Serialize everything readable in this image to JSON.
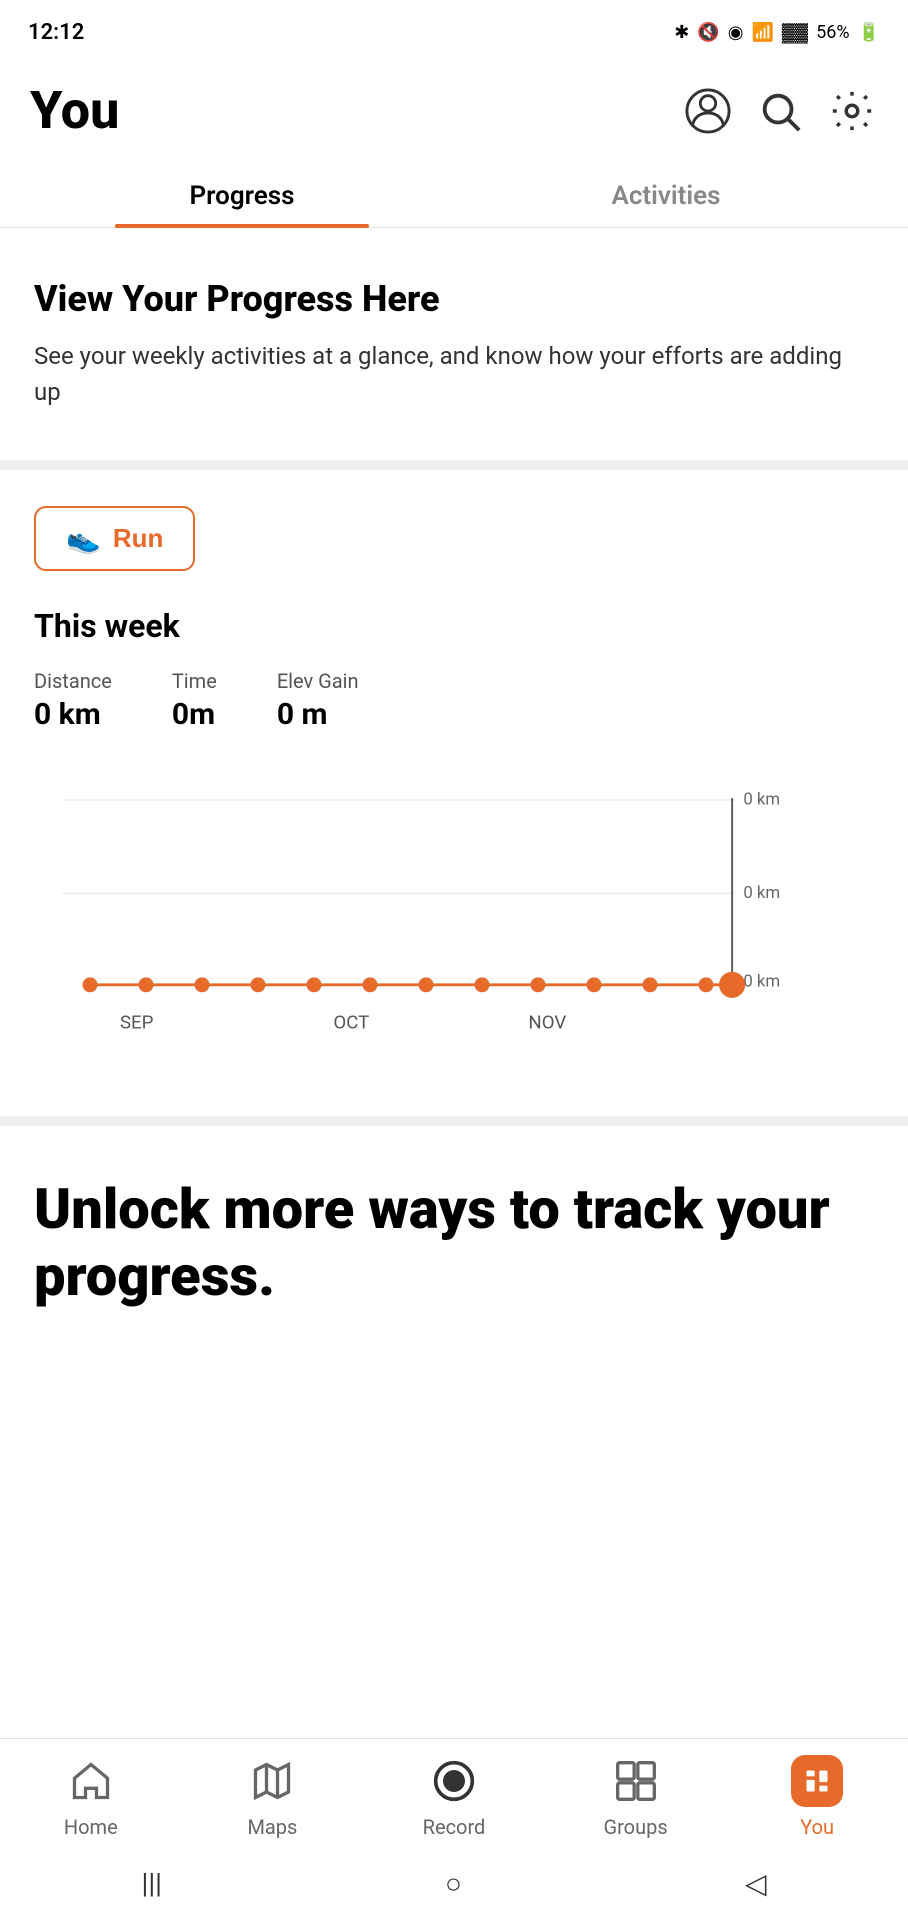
{
  "statusBar": {
    "time": "12:12",
    "battery": "56%"
  },
  "header": {
    "title": "You",
    "profileIcon": "person-circle-icon",
    "searchIcon": "search-icon",
    "settingsIcon": "gear-icon"
  },
  "tabs": [
    {
      "label": "Progress",
      "active": true
    },
    {
      "label": "Activities",
      "active": false
    }
  ],
  "progressBanner": {
    "heading": "View Your Progress Here",
    "description": "See your weekly activities at a glance, and know how your efforts are adding up"
  },
  "runSection": {
    "runButtonLabel": "Run",
    "thisWeekLabel": "This week",
    "stats": [
      {
        "label": "Distance",
        "value": "0 km"
      },
      {
        "label": "Time",
        "value": "0m"
      },
      {
        "label": "Elev Gain",
        "value": "0 m"
      }
    ],
    "chart": {
      "yLabels": [
        "0 km",
        "0 km",
        "0 km"
      ],
      "xLabels": [
        "SEP",
        "OCT",
        "NOV"
      ]
    }
  },
  "unlockSection": {
    "heading": "Unlock more ways to track your progress."
  },
  "bottomNav": [
    {
      "label": "Home",
      "icon": "home-icon",
      "active": false
    },
    {
      "label": "Maps",
      "icon": "maps-icon",
      "active": false
    },
    {
      "label": "Record",
      "icon": "record-icon",
      "active": false
    },
    {
      "label": "Groups",
      "icon": "groups-icon",
      "active": false
    },
    {
      "label": "You",
      "icon": "you-icon",
      "active": true
    }
  ],
  "systemNav": {
    "backLabel": "◁",
    "homeLabel": "○",
    "recentsLabel": "|||"
  },
  "colors": {
    "accent": "#e86a2a",
    "activeTab": "#000",
    "inactiveTab": "#888"
  }
}
